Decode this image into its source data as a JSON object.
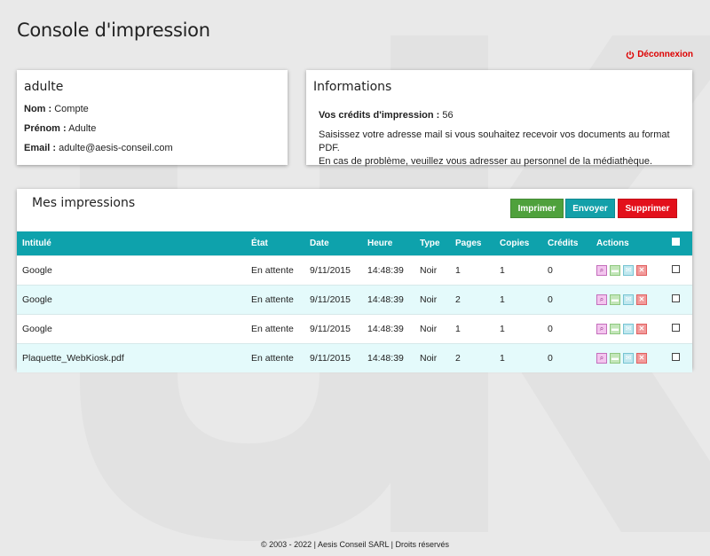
{
  "page_title": "Console d'impression",
  "logout_label": "Déconnexion",
  "user": {
    "title": "adulte",
    "name_label": "Nom :",
    "name": "Compte",
    "firstname_label": "Prénom :",
    "firstname": "Adulte",
    "email_label": "Email :",
    "email": "adulte@aesis-conseil.com"
  },
  "info": {
    "title": "Informations",
    "credits_label": "Vos crédits d'impression :",
    "credits": "56",
    "line1": "Saisissez votre adresse mail si vous souhaitez recevoir vos documents au format PDF.",
    "line2": "En cas de problème, veuillez vous adresser au personnel de la médiathèque."
  },
  "jobs": {
    "title": "Mes impressions",
    "print_label": "Imprimer",
    "send_label": "Envoyer",
    "delete_label": "Supprimer",
    "columns": [
      "Intitulé",
      "État",
      "Date",
      "Heure",
      "Type",
      "Pages",
      "Copies",
      "Crédits",
      "Actions"
    ],
    "rows": [
      {
        "name": "Google",
        "status": "En attente",
        "date": "9/11/2015",
        "time": "14:48:39",
        "type": "Noir",
        "pages": "1",
        "copies": "1",
        "credits": "0"
      },
      {
        "name": "Google",
        "status": "En attente",
        "date": "9/11/2015",
        "time": "14:48:39",
        "type": "Noir",
        "pages": "2",
        "copies": "1",
        "credits": "0"
      },
      {
        "name": "Google",
        "status": "En attente",
        "date": "9/11/2015",
        "time": "14:48:39",
        "type": "Noir",
        "pages": "1",
        "copies": "1",
        "credits": "0"
      },
      {
        "name": "Plaquette_WebKiosk.pdf",
        "status": "En attente",
        "date": "9/11/2015",
        "time": "14:48:39",
        "type": "Noir",
        "pages": "2",
        "copies": "1",
        "credits": "0"
      }
    ]
  },
  "footer": "© 2003 - 2022 | Aesis Conseil SARL | Droits réservés",
  "colors": {
    "accent": "#0ea2ac",
    "print": "#4fa13c",
    "send": "#13a0a9",
    "delete": "#e3101b",
    "logout": "#dd0000"
  },
  "icons": [
    "power-icon",
    "view-icon",
    "print-icon",
    "mail-icon",
    "delete-icon",
    "checkbox-icon"
  ]
}
